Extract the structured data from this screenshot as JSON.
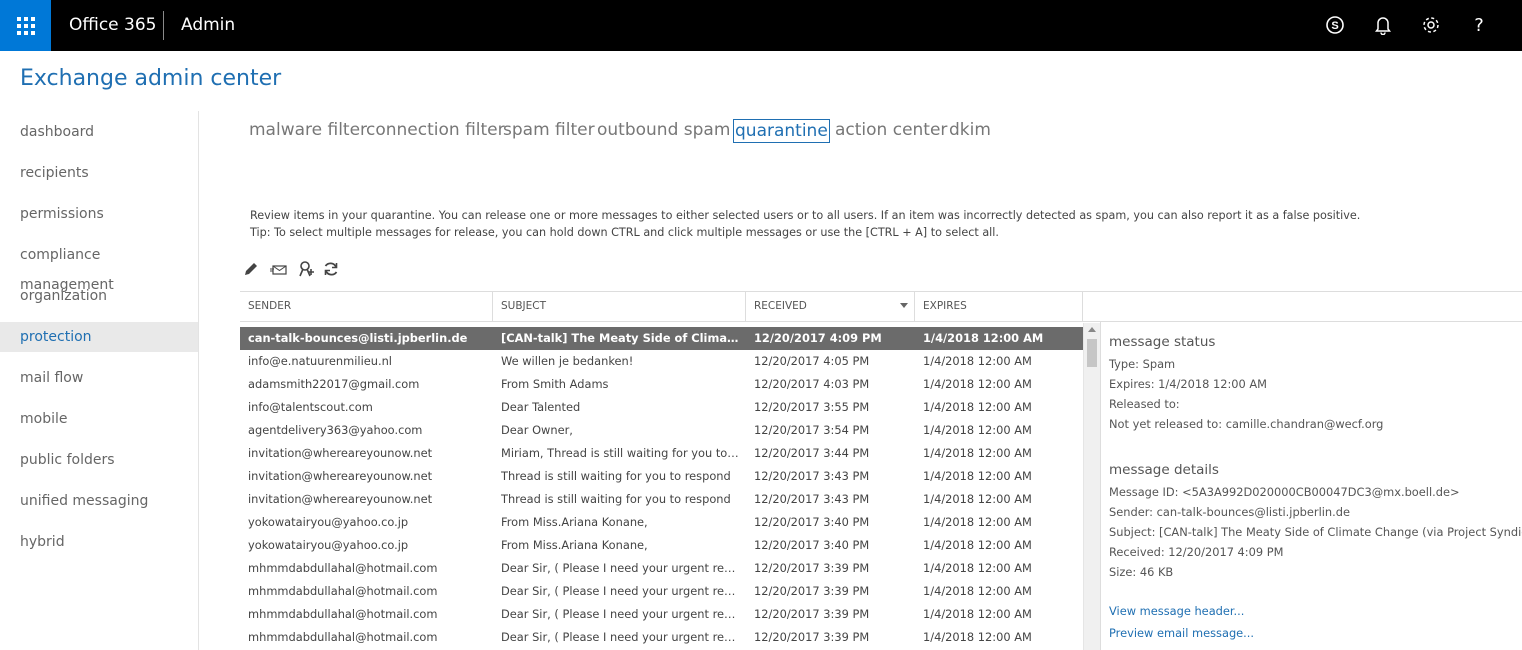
{
  "topbar": {
    "brand": "Office 365",
    "app": "Admin",
    "icons": [
      "app-launcher-icon",
      "skype-icon",
      "bell-icon",
      "gear-icon",
      "help-icon"
    ],
    "help_label": "?"
  },
  "page_title": "Exchange admin center",
  "nav": {
    "items": [
      {
        "label": "dashboard"
      },
      {
        "label": "recipients"
      },
      {
        "label": "permissions"
      },
      {
        "label": "compliance management"
      },
      {
        "label": "organization"
      },
      {
        "label": "protection",
        "active": true
      },
      {
        "label": "mail flow"
      },
      {
        "label": "mobile"
      },
      {
        "label": "public folders"
      },
      {
        "label": "unified messaging"
      },
      {
        "label": "hybrid"
      }
    ]
  },
  "tabs": [
    {
      "label": "malware filter"
    },
    {
      "label": "connection filter"
    },
    {
      "label": "spam filter"
    },
    {
      "label": "outbound spam"
    },
    {
      "label": "quarantine",
      "active": true
    },
    {
      "label": "action center"
    },
    {
      "label": "dkim"
    }
  ],
  "description": {
    "line1": "Review items in your quarantine. You can release one or more messages to either selected users or to all users. If an item was incorrectly detected as spam, you can also report it as a false positive.",
    "line2": "Tip: To select multiple messages for release, you can hold down CTRL and click multiple messages or use the [CTRL + A] to select all."
  },
  "toolbar": {
    "icons": [
      "edit-icon",
      "release-message-icon",
      "report-false-positive-icon",
      "refresh-icon"
    ]
  },
  "table": {
    "columns": [
      "SENDER",
      "SUBJECT",
      "RECEIVED",
      "EXPIRES"
    ],
    "sort_column": "RECEIVED",
    "rows": [
      {
        "sender": "can-talk-bounces@listi.jpberlin.de",
        "subject": "[CAN-talk] The Meaty Side of Climate Change (via Project Syndicate)",
        "received": "12/20/2017 4:09 PM",
        "expires": "1/4/2018 12:00 AM",
        "selected": true
      },
      {
        "sender": "info@e.natuurenmilieu.nl",
        "subject": "We willen je bedanken!",
        "received": "12/20/2017 4:05 PM",
        "expires": "1/4/2018 12:00 AM"
      },
      {
        "sender": "adamsmith22017@gmail.com",
        "subject": "From Smith Adams",
        "received": "12/20/2017 4:03 PM",
        "expires": "1/4/2018 12:00 AM"
      },
      {
        "sender": "info@talentscout.com",
        "subject": "Dear Talented",
        "received": "12/20/2017 3:55 PM",
        "expires": "1/4/2018 12:00 AM"
      },
      {
        "sender": "agentdelivery363@yahoo.com",
        "subject": "Dear Owner,",
        "received": "12/20/2017 3:54 PM",
        "expires": "1/4/2018 12:00 AM"
      },
      {
        "sender": "invitation@whereareyounow.net",
        "subject": "Miriam, Thread is still waiting for you to respond",
        "received": "12/20/2017 3:44 PM",
        "expires": "1/4/2018 12:00 AM"
      },
      {
        "sender": "invitation@whereareyounow.net",
        "subject": "Thread is still waiting for you to respond",
        "received": "12/20/2017 3:43 PM",
        "expires": "1/4/2018 12:00 AM"
      },
      {
        "sender": "invitation@whereareyounow.net",
        "subject": "Thread is still waiting for you to respond",
        "received": "12/20/2017 3:43 PM",
        "expires": "1/4/2018 12:00 AM"
      },
      {
        "sender": "yokowatairyou@yahoo.co.jp",
        "subject": "From Miss.Ariana Konane,",
        "received": "12/20/2017 3:40 PM",
        "expires": "1/4/2018 12:00 AM"
      },
      {
        "sender": "yokowatairyou@yahoo.co.jp",
        "subject": "From Miss.Ariana Konane,",
        "received": "12/20/2017 3:40 PM",
        "expires": "1/4/2018 12:00 AM"
      },
      {
        "sender": "mhmmdabdullahal@hotmail.com",
        "subject": "Dear Sir, ( Please I need your urgent reply.",
        "received": "12/20/2017 3:39 PM",
        "expires": "1/4/2018 12:00 AM"
      },
      {
        "sender": "mhmmdabdullahal@hotmail.com",
        "subject": "Dear Sir, ( Please I need your urgent reply.",
        "received": "12/20/2017 3:39 PM",
        "expires": "1/4/2018 12:00 AM"
      },
      {
        "sender": "mhmmdabdullahal@hotmail.com",
        "subject": "Dear Sir, ( Please I need your urgent reply.",
        "received": "12/20/2017 3:39 PM",
        "expires": "1/4/2018 12:00 AM"
      },
      {
        "sender": "mhmmdabdullahal@hotmail.com",
        "subject": "Dear Sir, ( Please I need your urgent reply.",
        "received": "12/20/2017 3:39 PM",
        "expires": "1/4/2018 12:00 AM"
      }
    ]
  },
  "details": {
    "status_heading": "message status",
    "type": "Type: Spam",
    "expires": "Expires: 1/4/2018 12:00 AM",
    "released_to": "Released to:",
    "not_yet_released": "Not yet released to: camille.chandran@wecf.org",
    "details_heading": "message details",
    "message_id": "Message ID: <5A3A992D020000CB00047DC3@mx.boell.de>",
    "sender": "Sender: can-talk-bounces@listi.jpberlin.de",
    "subject": "Subject: [CAN-talk] The Meaty Side of Climate Change (via Project Syndicate)",
    "received": "Received: 12/20/2017 4:09 PM",
    "size": "Size: 46 KB",
    "link_header": "View message header...",
    "link_preview": "Preview email message..."
  }
}
